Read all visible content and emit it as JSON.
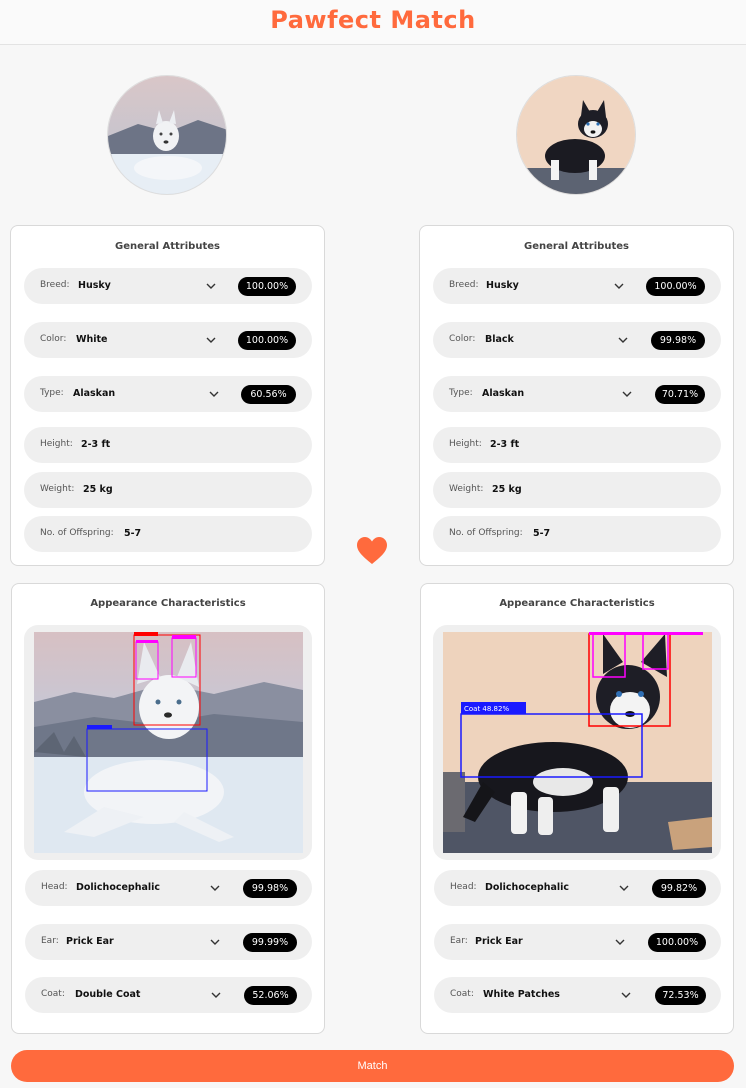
{
  "app": {
    "title": "Pawfect Match"
  },
  "colors": {
    "accent": "#ff6a3d",
    "badge": "#000000",
    "pill": "#efefef"
  },
  "left_dog": {
    "general": {
      "title": "General Attributes",
      "breed": {
        "label": "Breed:",
        "value": "Husky",
        "pct": "100.00%"
      },
      "color": {
        "label": "Color:",
        "value": "White",
        "pct": "100.00%"
      },
      "type": {
        "label": "Type:",
        "value": "Alaskan",
        "pct": "60.56%"
      },
      "height": {
        "label": "Height:",
        "value": "2-3 ft"
      },
      "weight": {
        "label": "Weight:",
        "value": "25 kg"
      },
      "offspring": {
        "label": "No. of Offspring:",
        "value": "5-7"
      }
    },
    "appearance": {
      "title": "Appearance Characteristics",
      "head": {
        "label": "Head:",
        "value": "Dolichocephalic",
        "pct": "99.98%"
      },
      "ear": {
        "label": "Ear:",
        "value": "Prick Ear",
        "pct": "99.99%"
      },
      "coat": {
        "label": "Coat:",
        "value": "Double Coat",
        "pct": "52.06%"
      }
    }
  },
  "right_dog": {
    "general": {
      "title": "General Attributes",
      "breed": {
        "label": "Breed:",
        "value": "Husky",
        "pct": "100.00%"
      },
      "color": {
        "label": "Color:",
        "value": "Black",
        "pct": "99.98%"
      },
      "type": {
        "label": "Type:",
        "value": "Alaskan",
        "pct": "70.71%"
      },
      "height": {
        "label": "Height:",
        "value": "2-3 ft"
      },
      "weight": {
        "label": "Weight:",
        "value": "25 kg"
      },
      "offspring": {
        "label": "No. of Offspring:",
        "value": "5-7"
      }
    },
    "appearance": {
      "title": "Appearance Characteristics",
      "coat_detection_label": "Coat 48.82%",
      "head": {
        "label": "Head:",
        "value": "Dolichocephalic",
        "pct": "99.82%"
      },
      "ear": {
        "label": "Ear:",
        "value": "Prick Ear",
        "pct": "100.00%"
      },
      "coat": {
        "label": "Coat:",
        "value": "White Patches",
        "pct": "72.53%"
      }
    }
  },
  "icons": {
    "heart": "heart-icon",
    "chevron": "chevron-down-icon"
  },
  "actions": {
    "match_label": "Match"
  }
}
